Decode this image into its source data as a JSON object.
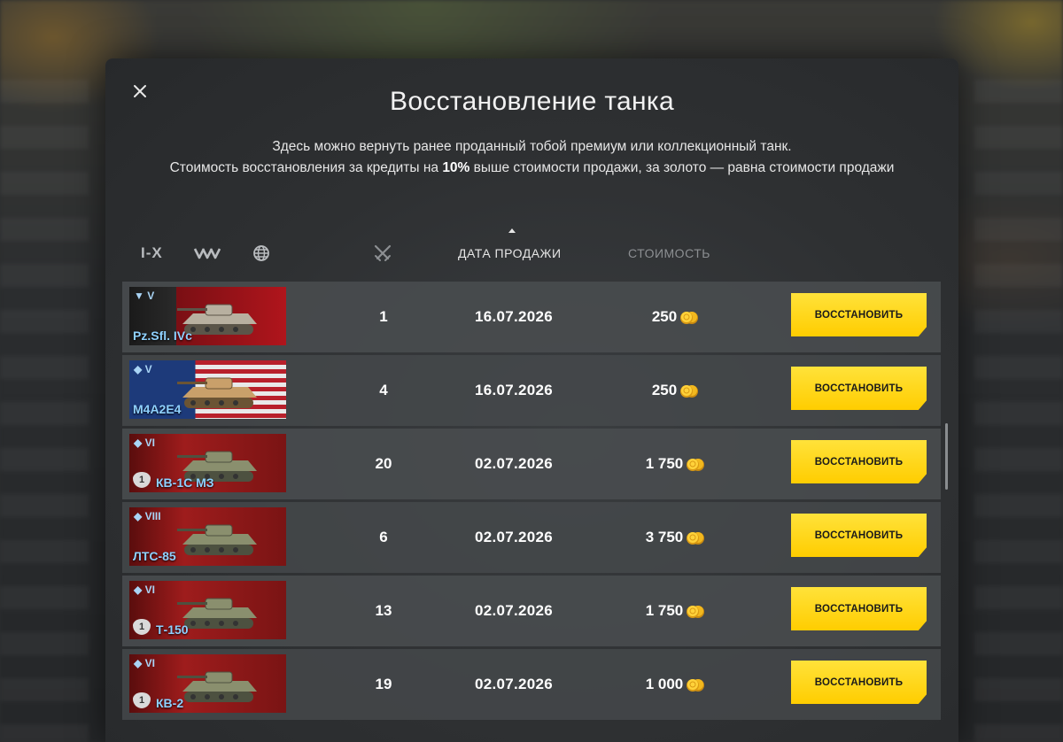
{
  "dialog": {
    "title": "Восстановление танка",
    "description_line1": "Здесь можно вернуть ранее проданный тобой премиум или коллекционный танк.",
    "description_line2_a": "Стоимость восстановления за кредиты на ",
    "description_line2_bold": "10%",
    "description_line2_b": " выше стоимости продажи, за золото — равна стоимости продажи",
    "close_label": "×"
  },
  "filters": {
    "tier_label": "I-X",
    "type_icon": "vehicle-type-icon",
    "nation_icon": "globe-icon",
    "battles_icon": "crossed-swords-icon",
    "date_label": "ДАТА ПРОДАЖИ",
    "cost_label": "СТОИМОСТЬ"
  },
  "rows": [
    {
      "tier": "V",
      "name": "Pz.Sfl. IVc",
      "nation": "germany",
      "type": "td",
      "mastery": "",
      "battles": "1",
      "date": "16.07.2026",
      "cost": "250",
      "button": "ВОССТАНОВИТЬ"
    },
    {
      "tier": "V",
      "name": "M4A2E4",
      "nation": "usa",
      "type": "medium",
      "mastery": "",
      "battles": "4",
      "date": "16.07.2026",
      "cost": "250",
      "button": "ВОССТАНОВИТЬ"
    },
    {
      "tier": "VI",
      "name": "КВ-1С МЗ",
      "nation": "ussr",
      "type": "heavy",
      "mastery": "1",
      "battles": "20",
      "date": "02.07.2026",
      "cost": "1 750",
      "button": "ВОССТАНОВИТЬ"
    },
    {
      "tier": "VIII",
      "name": "ЛТС-85",
      "nation": "ussr",
      "type": "light",
      "mastery": "",
      "battles": "6",
      "date": "02.07.2026",
      "cost": "3 750",
      "button": "ВОССТАНОВИТЬ"
    },
    {
      "tier": "VI",
      "name": "Т-150",
      "nation": "ussr",
      "type": "heavy",
      "mastery": "1",
      "battles": "13",
      "date": "02.07.2026",
      "cost": "1 750",
      "button": "ВОССТАНОВИТЬ"
    },
    {
      "tier": "VI",
      "name": "КВ-2",
      "nation": "ussr",
      "type": "heavy",
      "mastery": "1",
      "battles": "19",
      "date": "02.07.2026",
      "cost": "1 000",
      "button": "ВОССТАНОВИТЬ"
    }
  ],
  "currency_icon": "gold-coins-icon",
  "colors": {
    "accent_button": "#ffd21a",
    "tank_name": "#8fd1ff"
  }
}
